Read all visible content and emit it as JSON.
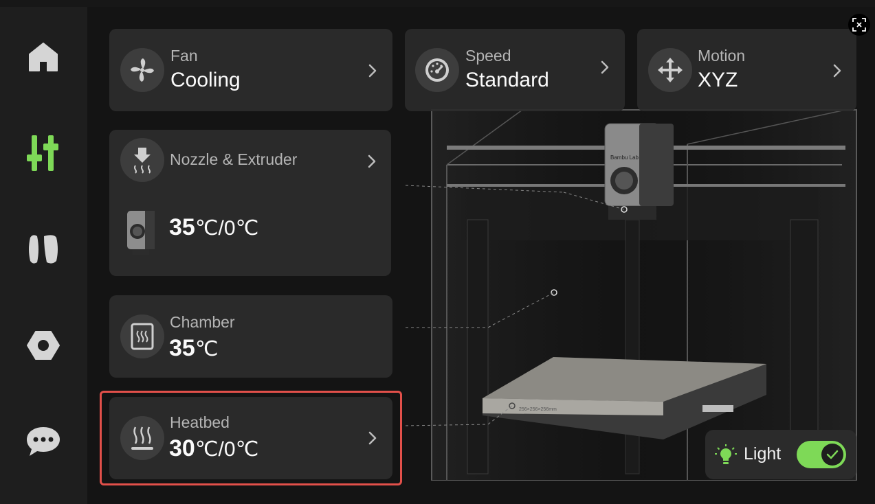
{
  "sidebar": {
    "items": [
      {
        "name": "home",
        "icon": "home-icon",
        "active": false
      },
      {
        "name": "control",
        "icon": "sliders-icon",
        "active": true
      },
      {
        "name": "filament",
        "icon": "filament-spool-icon",
        "active": false
      },
      {
        "name": "settings",
        "icon": "hex-nut-icon",
        "active": false
      },
      {
        "name": "messages",
        "icon": "chat-bubble-icon",
        "active": false
      }
    ]
  },
  "colors": {
    "accent": "#7ed957",
    "highlight": "#e2504a",
    "card": "#2a2a2a"
  },
  "fan": {
    "label": "Fan",
    "value": "Cooling",
    "icon": "fan-icon"
  },
  "speed": {
    "label": "Speed",
    "value": "Standard",
    "icon": "speedometer-icon"
  },
  "motion": {
    "label": "Motion",
    "value": "XYZ",
    "icon": "move-arrows-icon"
  },
  "nozzle": {
    "label": "Nozzle & Extruder",
    "temp": "35",
    "unit": "℃",
    "sep": "/",
    "target": "0",
    "target_unit": "℃",
    "icon": "extruder-heat-icon"
  },
  "chamber": {
    "label": "Chamber",
    "temp": "35",
    "unit": "℃",
    "icon": "chamber-heat-icon"
  },
  "heatbed": {
    "label": "Heatbed",
    "temp": "30",
    "unit": "℃",
    "sep": "/",
    "target": "0",
    "target_unit": "℃",
    "icon": "heatbed-icon"
  },
  "printer": {
    "brand": "Bambu Lab",
    "plate_text": "256×256×256mm"
  },
  "light": {
    "label": "Light",
    "on": true,
    "icon": "lightbulb-icon"
  }
}
